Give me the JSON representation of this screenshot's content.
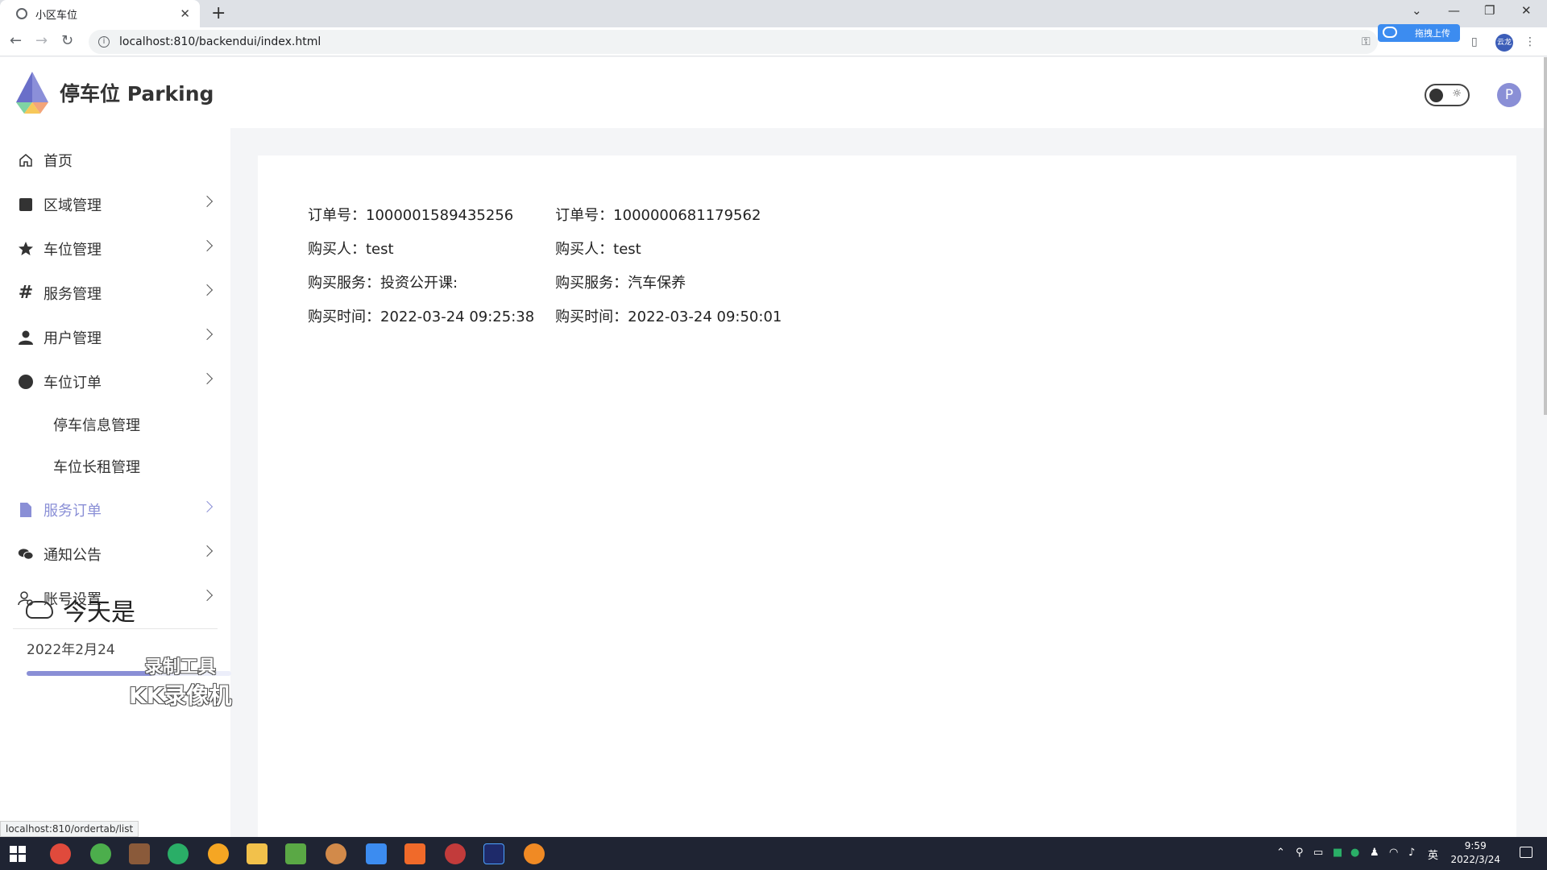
{
  "browser": {
    "tab_title": "小区车位",
    "tab_close": "✕",
    "new_tab": "+",
    "url": "localhost:810/backendui/index.html",
    "upload_label": "拖拽上传",
    "profile_initial": "云龙",
    "status_url": "localhost:810/ordertab/list"
  },
  "app": {
    "logo_text": "停车位 Parking",
    "user_initial": "P",
    "theme_icon": "☼"
  },
  "sidebar": {
    "items": [
      {
        "label": "首页",
        "icon": "home-icon",
        "has_children": false
      },
      {
        "label": "区域管理",
        "icon": "square-icon",
        "has_children": true
      },
      {
        "label": "车位管理",
        "icon": "star-icon",
        "has_children": true
      },
      {
        "label": "服务管理",
        "icon": "hash-icon",
        "has_children": true
      },
      {
        "label": "用户管理",
        "icon": "user-icon",
        "has_children": true
      },
      {
        "label": "车位订单",
        "icon": "circle-icon",
        "has_children": true
      }
    ],
    "sub_items": [
      "停车信息管理",
      "车位长租管理"
    ],
    "items_after": [
      {
        "label": "服务订单",
        "icon": "file-icon",
        "has_children": true,
        "active": true
      },
      {
        "label": "通知公告",
        "icon": "chat-icon",
        "has_children": true
      },
      {
        "label": "账号设置",
        "icon": "user-gear-icon",
        "has_children": true
      }
    ]
  },
  "weather": {
    "title": "今天是",
    "date": "2022年2月24",
    "progress": 0.62
  },
  "watermark": {
    "line1": "录制工具",
    "line2": "KK录像机"
  },
  "orders": [
    {
      "order_no_label": "订单号：",
      "order_no": "1000001589435256",
      "buyer_label": "购买人：",
      "buyer": "test",
      "service_label": "购买服务：",
      "service": "投资公开课:",
      "time_label": "购买时间：",
      "time": "2022-03-24 09:25:38"
    },
    {
      "order_no_label": "订单号：",
      "order_no": "1000000681179562",
      "buyer_label": "购买人：",
      "buyer": "test",
      "service_label": "购买服务：",
      "service": "汽车保养",
      "time_label": "购买时间：",
      "time": "2022-03-24 09:50:01"
    }
  ],
  "taskbar": {
    "time": "9:59",
    "date": "2022/3/24",
    "ime": "英"
  }
}
